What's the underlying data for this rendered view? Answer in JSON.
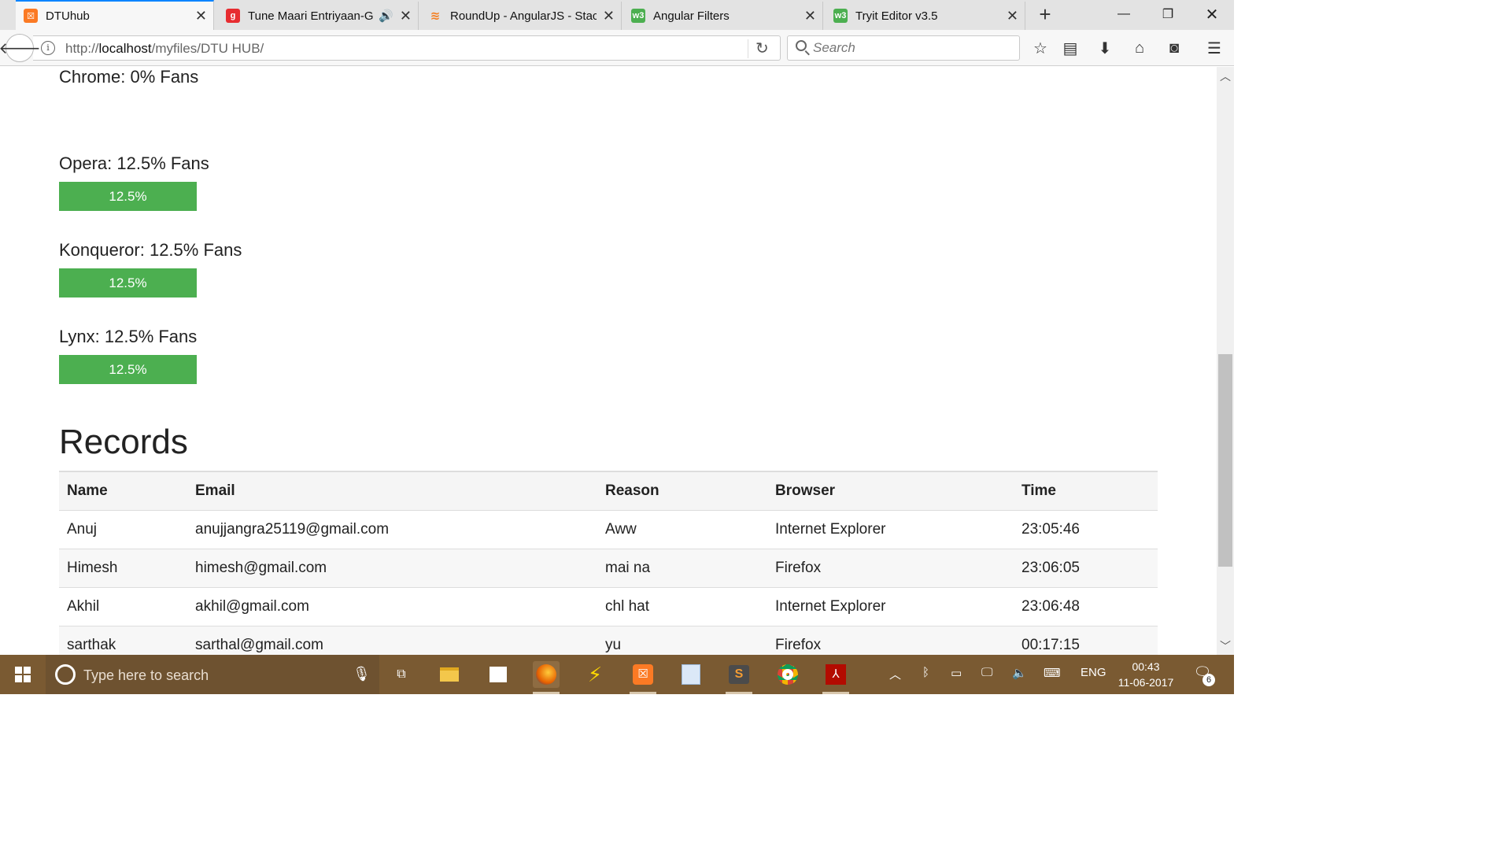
{
  "browser": {
    "tabs": [
      {
        "title": "DTUhub",
        "favicon": "xampp-icon",
        "color": "#fb7a24",
        "active": true
      },
      {
        "title": "Tune Maari Entriyaan-Gu",
        "favicon": "gaana-icon",
        "color": "#e72c30",
        "active": false,
        "audio": true
      },
      {
        "title": "RoundUp - AngularJS - Stack",
        "favicon": "stackoverflow-icon",
        "color": "#f48024",
        "active": false
      },
      {
        "title": "Angular Filters",
        "favicon": "w3schools-icon",
        "color": "#4caf50",
        "active": false
      },
      {
        "title": "Tryit Editor v3.5",
        "favicon": "w3schools-icon",
        "color": "#4caf50",
        "active": false
      }
    ],
    "url": {
      "scheme": "http://",
      "host": "localhost",
      "path": "/myfiles/DTU HUB/"
    },
    "search_placeholder": "Search"
  },
  "stats": [
    {
      "label": "Chrome: 0% Fans",
      "percent": 0,
      "bar_text": "",
      "bar_fraction": 0
    },
    {
      "label": "Opera: 12.5% Fans",
      "percent": 12.5,
      "bar_text": "12.5%",
      "bar_fraction": 0.125
    },
    {
      "label": "Konqueror: 12.5% Fans",
      "percent": 12.5,
      "bar_text": "12.5%",
      "bar_fraction": 0.125
    },
    {
      "label": "Lynx: 12.5% Fans",
      "percent": 12.5,
      "bar_text": "12.5%",
      "bar_fraction": 0.125
    }
  ],
  "bar_color": "#4caf50",
  "records": {
    "title": "Records",
    "columns": [
      "Name",
      "Email",
      "Reason",
      "Browser",
      "Time"
    ],
    "rows": [
      [
        "Anuj",
        "anujjangra25119@gmail.com",
        "Aww",
        "Internet Explorer",
        "23:05:46"
      ],
      [
        "Himesh",
        "himesh@gmail.com",
        "mai na",
        "Firefox",
        "23:06:05"
      ],
      [
        "Akhil",
        "akhil@gmail.com",
        "chl hat",
        "Internet Explorer",
        "23:06:48"
      ],
      [
        "sarthak",
        "sarthal@gmail.com",
        "yu",
        "Firefox",
        "00:17:15"
      ]
    ]
  },
  "taskbar": {
    "search_placeholder": "Type here to search",
    "clock_time": "00:43",
    "clock_date": "11-06-2017",
    "language": "ENG",
    "notifications": "6",
    "background": "#7a5a32"
  }
}
